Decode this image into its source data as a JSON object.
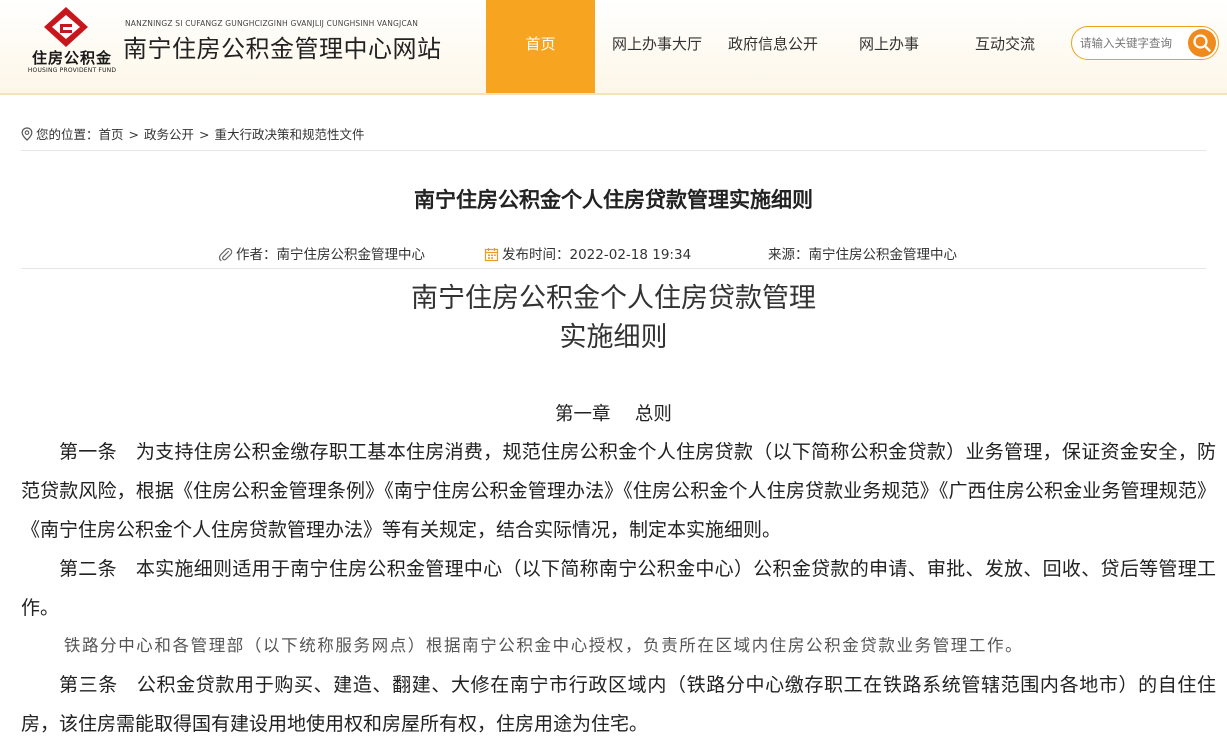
{
  "header": {
    "logo_text": "住房公积金",
    "logo_en": "HOUSING PROVIDENT FUND",
    "site_pinyin": "NANZNINGZ SI CUFANGZ GUNGHCIZGINH GVANJLIJ CUNGHSINH VANGJCAN",
    "site_name": "南宁住房公积金管理中心网站",
    "nav": [
      {
        "label": "首页"
      },
      {
        "label": "网上办事大厅"
      },
      {
        "label": "政府信息公开"
      },
      {
        "label": "网上办事"
      },
      {
        "label": "互动交流"
      }
    ],
    "search_placeholder": "请输入关键字查询",
    "colors": {
      "accent": "#f7a521",
      "logo_red": "#c8161d"
    }
  },
  "breadcrumb": {
    "prefix": "您的位置：",
    "items": [
      "首页",
      "政务公开",
      "重大行政决策和规范性文件"
    ],
    "separator": ">"
  },
  "article": {
    "title": "南宁住房公积金个人住房贷款管理实施细则",
    "meta": {
      "author_label": "作者：",
      "author": "南宁住房公积金管理中心",
      "time_label": "发布时间：",
      "time": "2022-02-18 19:34",
      "source_label": "来源：",
      "source": "南宁住房公积金管理中心"
    },
    "doc_title_line1": "南宁住房公积金个人住房贷款管理",
    "doc_title_line2": "实施细则",
    "chapter": "第一章　 总则",
    "paragraphs": [
      {
        "article": "第一条",
        "text": "为支持住房公积金缴存职工基本住房消费，规范住房公积金个人住房贷款（以下简称公积金贷款）业务管理，保证资金安全，防范贷款风险，根据《住房公积金管理条例》《南宁住房公积金管理办法》《住房公积金个人住房贷款业务规范》《广西住房公积金业务管理规范》《南宁住房公积金个人住房贷款管理办法》等有关规定，结合实际情况，制定本实施细则。"
      },
      {
        "article": "第二条",
        "text": "本实施细则适用于南宁住房公积金管理中心（以下简称南宁公积金中心）公积金贷款的申请、审批、发放、回收、贷后等管理工作。"
      },
      {
        "article": "",
        "text": "铁路分中心和各管理部（以下统称服务网点）根据南宁公积金中心授权，负责所在区域内住房公积金贷款业务管理工作。"
      },
      {
        "article": "第三条",
        "text": "公积金贷款用于购买、建造、翻建、大修在南宁市行政区域内（铁路分中心缴存职工在铁路系统管辖范围内各地市）的自住住房，该住房需能取得国有建设用地使用权和房屋所有权，住房用途为住宅。"
      }
    ]
  }
}
